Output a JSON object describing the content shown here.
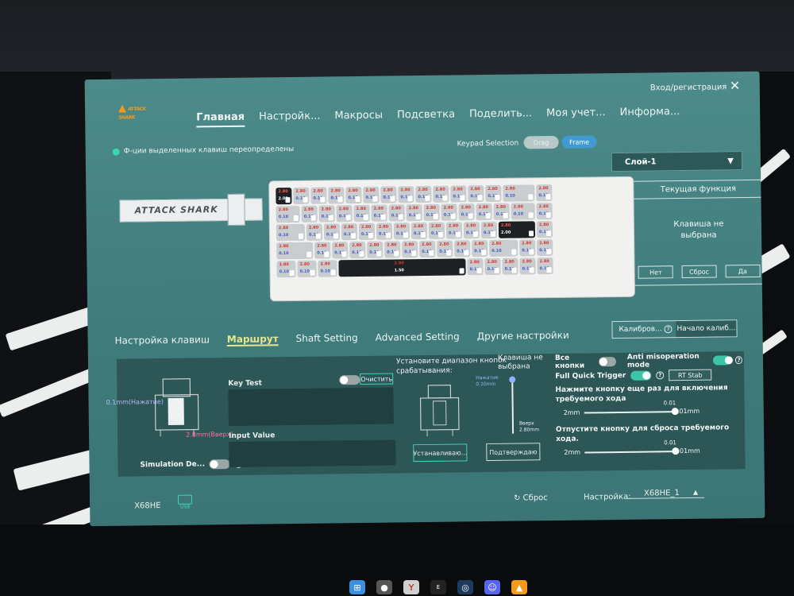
{
  "header": {
    "login": "Вход/регистрация",
    "close_glyph": "✕",
    "logo_text": "ATTACK SHARK",
    "nav": [
      "Главная",
      "Настройк...",
      "Макросы",
      "Подсветка",
      "Поделить...",
      "Моя учет...",
      "Информа..."
    ]
  },
  "notice": "Ф-ции выделенных клавиш переопределены",
  "keypad": {
    "label": "Keypad Selection",
    "drag": "Drag",
    "frame": "Frame"
  },
  "layer": {
    "value": "Слой-1",
    "caret": "▼"
  },
  "current_function": {
    "title": "Текущая функция",
    "message_line1": "Клавиша не",
    "message_line2": "выбрана",
    "buttons": [
      "Нет",
      "Сброс",
      "Да"
    ]
  },
  "keyboard": {
    "cable_brand": "ATTACK SHARK",
    "key_top_value": "2.80",
    "key_bottom_value": "0.10",
    "dark_key_top": "2.80",
    "dark_key_bottom": "2.00",
    "space_top": "2.80",
    "space_bottom": "1.50"
  },
  "subtabs": [
    "Настройка клавиш",
    "Маршрут",
    "Shaft Setting",
    "Advanced Setting",
    "Другие настройки"
  ],
  "calibration": {
    "left": "Калибров...",
    "right": "Начало калиб..."
  },
  "panel": {
    "press_label": "0.1mm(Нажатие)",
    "up_label": "2.8mm(Вверх)",
    "simulation": "Simulation De...",
    "key_test": "Key Test",
    "clear": "Очистить",
    "input_value": "Input Value",
    "range_label": "Установите диапазон кнопок срабатывания:",
    "no_key_label": "Клавиша не выбрана",
    "press_text": "Нажатие",
    "press_value": "0.10mm",
    "up_text": "Вверх",
    "up_value": "2.80mm",
    "set_button": "Устанавливаю...",
    "confirm_button": "Подтверждаю",
    "all_keys": "Все кнопки",
    "anti_misoperation": "Anti misoperation mode",
    "full_quick_trigger": "Full Quick Trigger",
    "rt_stab": "RT Stab",
    "press_again_text": "Нажмите кнопку еще раз для включения требуемого хода",
    "slider1_min": "2mm",
    "slider1_max": "0.01mm",
    "slider1_val": "0.01",
    "release_text": "Отпустите кнопку для сброса требуемого хода.",
    "slider2_min": "2mm",
    "slider2_max": "0.01mm",
    "slider2_val": "0.01"
  },
  "footer": {
    "model": "X68HE",
    "usb": "USB",
    "reset": "Сброс",
    "setting_label": "Настройка:",
    "setting_value": "X68HE_1"
  },
  "taskbar_icons": [
    "windows-icon",
    "chrome-icon",
    "yandex-icon",
    "epic-icon",
    "steam-icon",
    "discord-icon",
    "app-icon"
  ],
  "colors": {
    "accent": "#3dd6b8",
    "frame_blue": "#3f9bd2",
    "panel": "#2d5656",
    "active_tab": "#e6e78c"
  }
}
